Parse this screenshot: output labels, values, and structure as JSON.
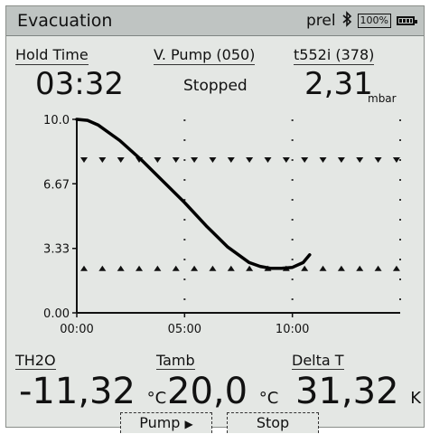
{
  "header": {
    "title": "Evacuation",
    "mode": "prel",
    "zoom": "100%",
    "bluetooth_icon": "bluetooth-icon",
    "battery_icon": "battery-icon"
  },
  "readouts": {
    "hold_time_label": "Hold Time",
    "hold_time_value": "03:32",
    "pump_label": "V. Pump (050)",
    "pump_status": "Stopped",
    "sensor_label": "t552i (378)",
    "pressure_value": "2,31",
    "pressure_unit": "mbar"
  },
  "chart_data": {
    "type": "line",
    "x_tick_labels": [
      "00:00",
      "05:00",
      "10:00"
    ],
    "y_tick_labels": [
      "10.0",
      "6.67",
      "3.33",
      "0.00"
    ],
    "ylim": [
      0,
      10
    ],
    "xlim": [
      0,
      15
    ],
    "grid": "dotted",
    "series": [
      {
        "x": [
          0,
          0.5,
          1,
          2,
          3,
          4,
          5,
          6,
          7,
          8,
          8.5,
          9,
          9.5,
          10,
          10.5,
          10.8
        ],
        "values": [
          10.0,
          9.95,
          9.7,
          8.9,
          7.9,
          6.8,
          5.7,
          4.5,
          3.4,
          2.6,
          2.4,
          2.3,
          2.3,
          2.35,
          2.6,
          3.0
        ]
      }
    ],
    "upper_limit": 7.9,
    "lower_limit": 2.3
  },
  "bottom": {
    "th2o_label": "TH2O",
    "th2o_value": "-11,32",
    "th2o_unit": "°C",
    "tamb_label": "Tamb",
    "tamb_value": "20,0",
    "tamb_unit": "°C",
    "delta_label": "Delta T",
    "delta_value": "31,32",
    "delta_unit": "K"
  },
  "softkeys": {
    "pump": "Pump",
    "pump_arrow": "▶",
    "stop": "Stop"
  }
}
